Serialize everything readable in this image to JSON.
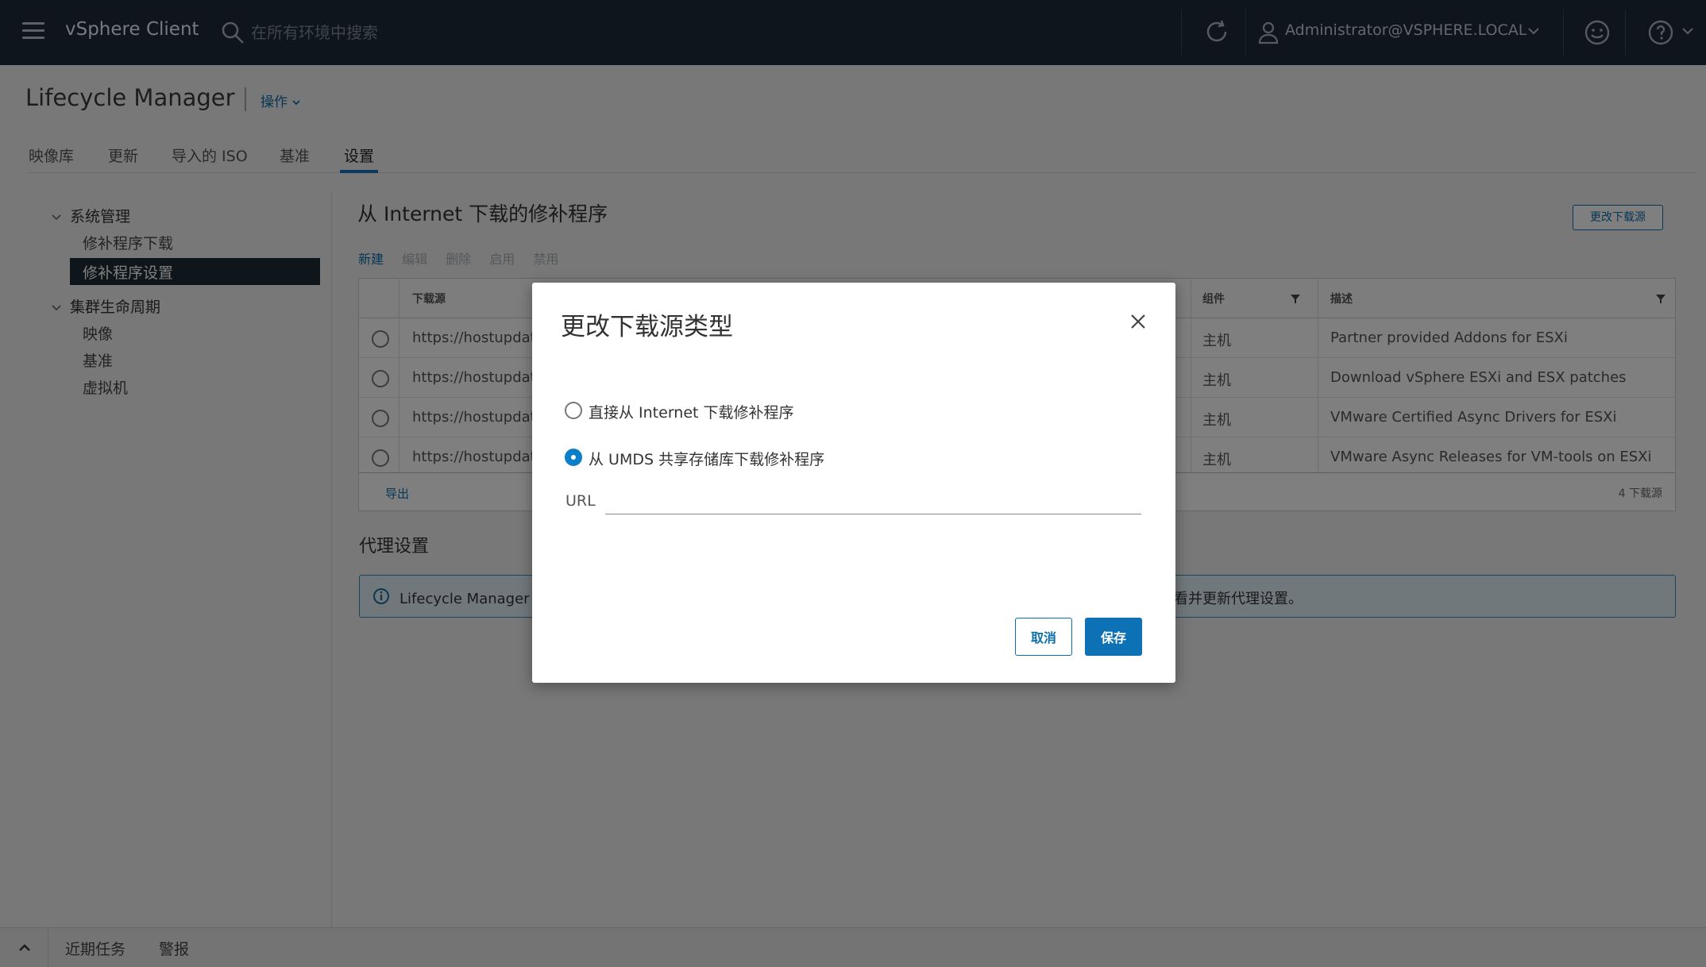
{
  "header": {
    "brand": "vSphere Client",
    "search_placeholder": "在所有环境中搜索",
    "user": "Administrator@VSPHERE.LOCAL"
  },
  "page": {
    "title": "Lifecycle Manager",
    "actions_label": "操作"
  },
  "tabs": [
    {
      "label": "映像库"
    },
    {
      "label": "更新"
    },
    {
      "label": "导入的 ISO"
    },
    {
      "label": "基准"
    },
    {
      "label": "设置",
      "active": true
    }
  ],
  "leftnav": {
    "groups": [
      {
        "label": "系统管理",
        "items": [
          "修补程序下载",
          "修补程序设置"
        ]
      },
      {
        "label": "集群生命周期",
        "items": [
          "映像",
          "基准",
          "虚拟机"
        ]
      }
    ],
    "selected": "修补程序设置"
  },
  "content": {
    "title": "从 Internet 下载的修补程序",
    "change_source_button": "更改下载源",
    "toolbar": {
      "new": "新建",
      "edit": "编辑",
      "delete": "删除",
      "enable": "启用",
      "disable": "禁用"
    },
    "grid": {
      "columns": [
        "下载源",
        "组件",
        "描述"
      ],
      "rows": [
        {
          "source": "https://hostupdate",
          "component": "主机",
          "description": "Partner provided Addons for ESXi"
        },
        {
          "source": "https://hostupdate",
          "component": "主机",
          "description": "Download vSphere ESXi and ESX patches"
        },
        {
          "source": "https://hostupdate",
          "component": "主机",
          "description": "VMware Certified Async Drivers for ESXi"
        },
        {
          "source": "https://hostupdate",
          "component": "主机",
          "description": "VMware Async Releases for VM-tools on ESXi"
        }
      ],
      "export": "导出",
      "count": "4 下载源"
    },
    "proxy_title": "代理设置",
    "info_left": "Lifecycle Manager 现",
    "info_right": "看并更新代理设置。"
  },
  "bottombar": {
    "recent_tasks": "近期任务",
    "alarms": "警报"
  },
  "modal": {
    "title": "更改下载源类型",
    "option_internet": "直接从 Internet 下载修补程序",
    "option_umds": "从 UMDS 共享存储库下载修补程序",
    "selected": "umds",
    "url_label": "URL",
    "url_value": "",
    "cancel": "取消",
    "save": "保存"
  },
  "colors": {
    "header_bg": "#1d2a36",
    "accent": "#0d72b5",
    "info_border": "#3a8bbf"
  }
}
